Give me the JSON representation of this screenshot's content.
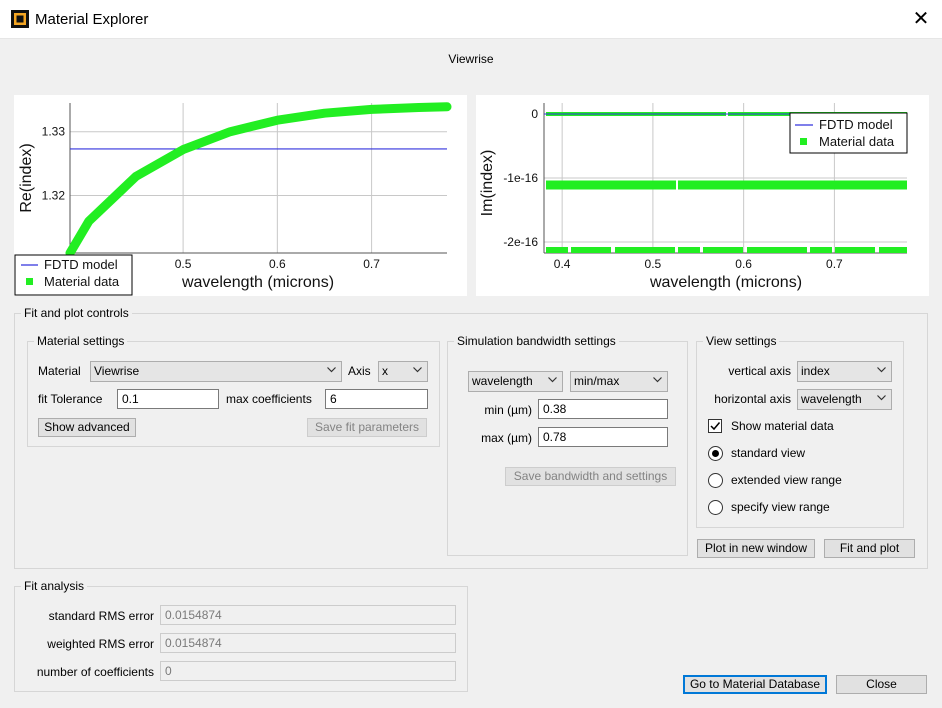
{
  "window": {
    "title": "Material Explorer",
    "close_glyph": "✕"
  },
  "plot_title": "Viewrise",
  "colors": {
    "model_line": "#3333dd",
    "material_data": "#22ee22",
    "grid": "#c8c8c8"
  },
  "chart_data": [
    {
      "type": "line",
      "xlabel": "wavelength (microns)",
      "ylabel": "Re(index)",
      "x_ticks": [
        "0.5",
        "0.6",
        "0.7"
      ],
      "y_ticks": [
        "1.32",
        "1.33"
      ],
      "legend": [
        "FDTD model",
        "Material data"
      ],
      "legend_position": "bottom-left",
      "series": [
        {
          "name": "FDTD model",
          "x": [
            0.38,
            0.78
          ],
          "y": [
            1.3273,
            1.3273
          ]
        },
        {
          "name": "Material data",
          "x": [
            0.38,
            0.4,
            0.45,
            0.5,
            0.55,
            0.6,
            0.65,
            0.7,
            0.75,
            0.78
          ],
          "y": [
            1.311,
            1.316,
            1.323,
            1.3272,
            1.33,
            1.3318,
            1.3329,
            1.3335,
            1.3338,
            1.3339
          ]
        }
      ]
    },
    {
      "type": "scatter",
      "xlabel": "wavelength (microns)",
      "ylabel": "Im(index)",
      "x_ticks": [
        "0.4",
        "0.5",
        "0.6",
        "0.7"
      ],
      "y_ticks": [
        "0",
        "-1e-16",
        "-2e-16"
      ],
      "legend": [
        "FDTD model",
        "Material data"
      ],
      "legend_position": "top-right",
      "series": [
        {
          "name": "FDTD model",
          "x": [
            0.38,
            0.78
          ],
          "y": [
            0,
            0
          ]
        },
        {
          "name": "Material data",
          "bands_y": [
            0,
            -1.11e-16,
            -2.22e-16
          ]
        }
      ]
    }
  ],
  "chart_tick_values": {
    "left_x": [
      "0.5",
      "0.6",
      "0.7"
    ],
    "left_y": [
      "1.32",
      "1.33"
    ],
    "right_x": [
      "0.4",
      "0.5",
      "0.6",
      "0.7"
    ],
    "right_y": [
      "0",
      "-1e-16",
      "-2e-16"
    ]
  },
  "fit_plot_controls": {
    "legend": "Fit and plot controls",
    "material_settings": {
      "legend": "Material settings",
      "material_label": "Material",
      "material_value": "Viewrise",
      "axis_label": "Axis",
      "axis_value": "x",
      "fit_tolerance_label": "fit Tolerance",
      "fit_tolerance_value": "0.1",
      "max_coefficients_label": "max coefficients",
      "max_coefficients_value": "6",
      "show_advanced": "Show advanced",
      "save_fit": "Save fit parameters"
    },
    "simulation_bandwidth": {
      "legend": "Simulation bandwidth settings",
      "unit_value": "wavelength",
      "range_mode_value": "min/max",
      "min_label": "min (µm)",
      "min_value": "0.38",
      "max_label": "max (µm)",
      "max_value": "0.78",
      "save_bandwidth": "Save bandwidth and settings"
    },
    "view_settings": {
      "legend": "View settings",
      "vertical_axis_label": "vertical axis",
      "vertical_axis_value": "index",
      "horizontal_axis_label": "horizontal axis",
      "horizontal_axis_value": "wavelength",
      "show_material_data": "Show material data",
      "show_material_data_checked": true,
      "radio_standard": "standard view",
      "radio_extended": "extended view range",
      "radio_specify": "specify view range",
      "selected_radio": "standard view"
    },
    "plot_new_window": "Plot in new window",
    "fit_and_plot": "Fit and plot"
  },
  "fit_analysis": {
    "legend": "Fit analysis",
    "standard_rms_label": "standard RMS error",
    "standard_rms_value": "0.0154874",
    "weighted_rms_label": "weighted RMS error",
    "weighted_rms_value": "0.0154874",
    "num_coeff_label": "number of coefficients",
    "num_coeff_value": "0"
  },
  "footer": {
    "go_to_db": "Go to Material Database",
    "close": "Close"
  },
  "icons": {
    "app": "app-icon",
    "close": "close-icon",
    "dropdown": "chevron-down-icon",
    "check": "checkmark-icon"
  }
}
